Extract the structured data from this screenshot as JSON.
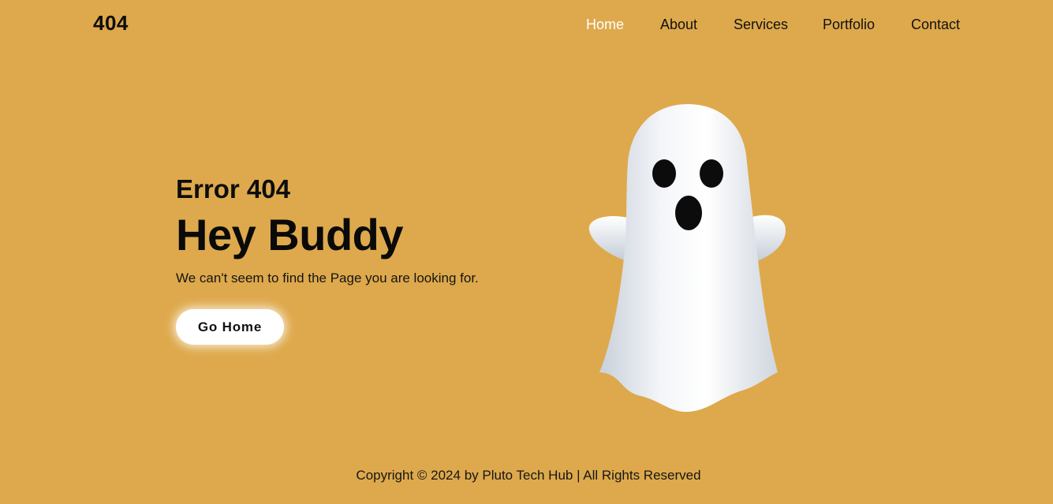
{
  "header": {
    "logo": "404",
    "nav": [
      {
        "label": "Home",
        "active": true
      },
      {
        "label": "About",
        "active": false
      },
      {
        "label": "Services",
        "active": false
      },
      {
        "label": "Portfolio",
        "active": false
      },
      {
        "label": "Contact",
        "active": false
      }
    ]
  },
  "hero": {
    "error_code": "Error 404",
    "headline": "Hey Buddy",
    "message": "We can't seem to find the Page you are looking for.",
    "button_label": "Go Home",
    "illustration": "ghost-icon"
  },
  "footer": {
    "copyright": "Copyright © 2024 by Pluto Tech Hub | All Rights Reserved"
  },
  "colors": {
    "background": "#dea94c",
    "active_nav": "#ffffff",
    "text": "#111111",
    "button_bg": "#ffffff"
  }
}
